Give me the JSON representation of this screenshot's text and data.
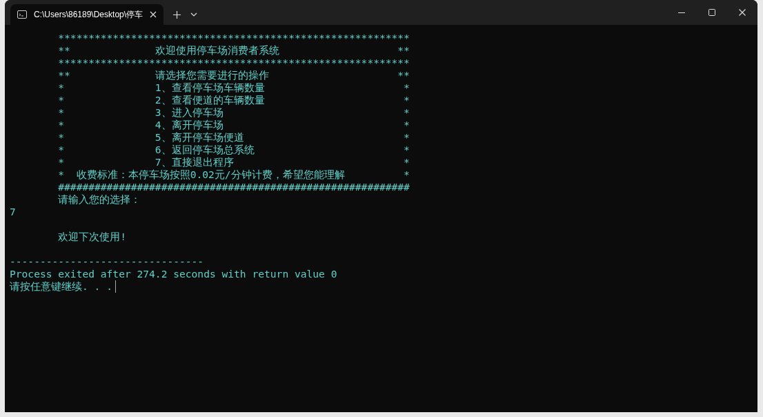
{
  "window": {
    "tabs": [
      {
        "title": "C:\\Users\\86189\\Desktop\\停车",
        "selected": true
      }
    ]
  },
  "console_lines": [
    {
      "kind": "border",
      "text": "**********************************************************"
    },
    {
      "kind": "menu",
      "left": "**",
      "text": "欢迎使用停车场消费者系统",
      "right": "**"
    },
    {
      "kind": "border",
      "text": "**********************************************************"
    },
    {
      "kind": "menu",
      "left": "**",
      "text": "请选择您需要进行的操作",
      "right": "**"
    },
    {
      "kind": "menu",
      "left": "*",
      "text": "1、查看停车场车辆数量",
      "right": "*"
    },
    {
      "kind": "menu",
      "left": "*",
      "text": "2、查看便道的车辆数量",
      "right": "*"
    },
    {
      "kind": "menu",
      "left": "*",
      "text": "3、进入停车场",
      "right": "*"
    },
    {
      "kind": "menu",
      "left": "*",
      "text": "4、离开停车场",
      "right": "*"
    },
    {
      "kind": "menu",
      "left": "*",
      "text": "5、离开停车场便道",
      "right": "*"
    },
    {
      "kind": "menu",
      "left": "*",
      "text": "6、返回停车场总系统",
      "right": "*"
    },
    {
      "kind": "menu",
      "left": "*",
      "text": "7、直接退出程序",
      "right": "*"
    },
    {
      "kind": "note",
      "left": "*",
      "text": "收费标准：本停车场按照0.02元/分钟计费，希望您能理解",
      "right": "*"
    },
    {
      "kind": "border",
      "text": "##########################################################"
    },
    {
      "kind": "indented",
      "text": "请输入您的选择："
    },
    {
      "kind": "plain",
      "text": "7"
    },
    {
      "kind": "blank"
    },
    {
      "kind": "indented",
      "text": "欢迎下次使用!"
    },
    {
      "kind": "blank"
    },
    {
      "kind": "plain",
      "text": "--------------------------------"
    },
    {
      "kind": "plain",
      "text": "Process exited after 274.2 seconds with return value 0"
    },
    {
      "kind": "plain",
      "text": "请按任意键继续. . .",
      "cursor": true
    }
  ]
}
